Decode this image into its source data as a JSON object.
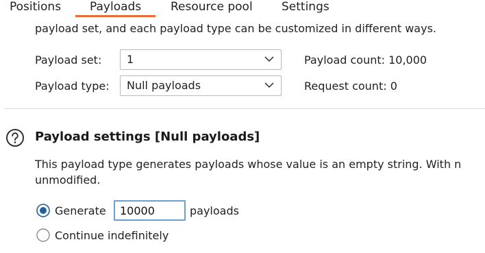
{
  "tabs": [
    {
      "label": "Positions",
      "active": false
    },
    {
      "label": "Payloads",
      "active": true
    },
    {
      "label": "Resource pool",
      "active": false
    },
    {
      "label": "Settings",
      "active": false
    }
  ],
  "intro_text": "payload set, and each payload type can be customized in different ways.",
  "payload_set": {
    "label": "Payload set:",
    "value": "1"
  },
  "payload_type": {
    "label": "Payload type:",
    "value": "Null payloads"
  },
  "payload_count": "Payload count: 10,000",
  "request_count": "Request count: 0",
  "settings": {
    "title": "Payload settings [Null payloads]",
    "description_line1": "This payload type generates payloads whose value is an empty string. With n",
    "description_line2": "unmodified.",
    "generate_label": "Generate",
    "generate_value": "10000",
    "generate_suffix": "payloads",
    "continue_label": "Continue indefinitely",
    "selected_option": "generate"
  },
  "colors": {
    "accent_tab": "#ee6a37",
    "radio_selected": "#1f5f9c",
    "input_focus_border": "#6b9fd0"
  },
  "icons": {
    "help": "help-circle-icon",
    "dropdown": "chevron-down-icon"
  }
}
